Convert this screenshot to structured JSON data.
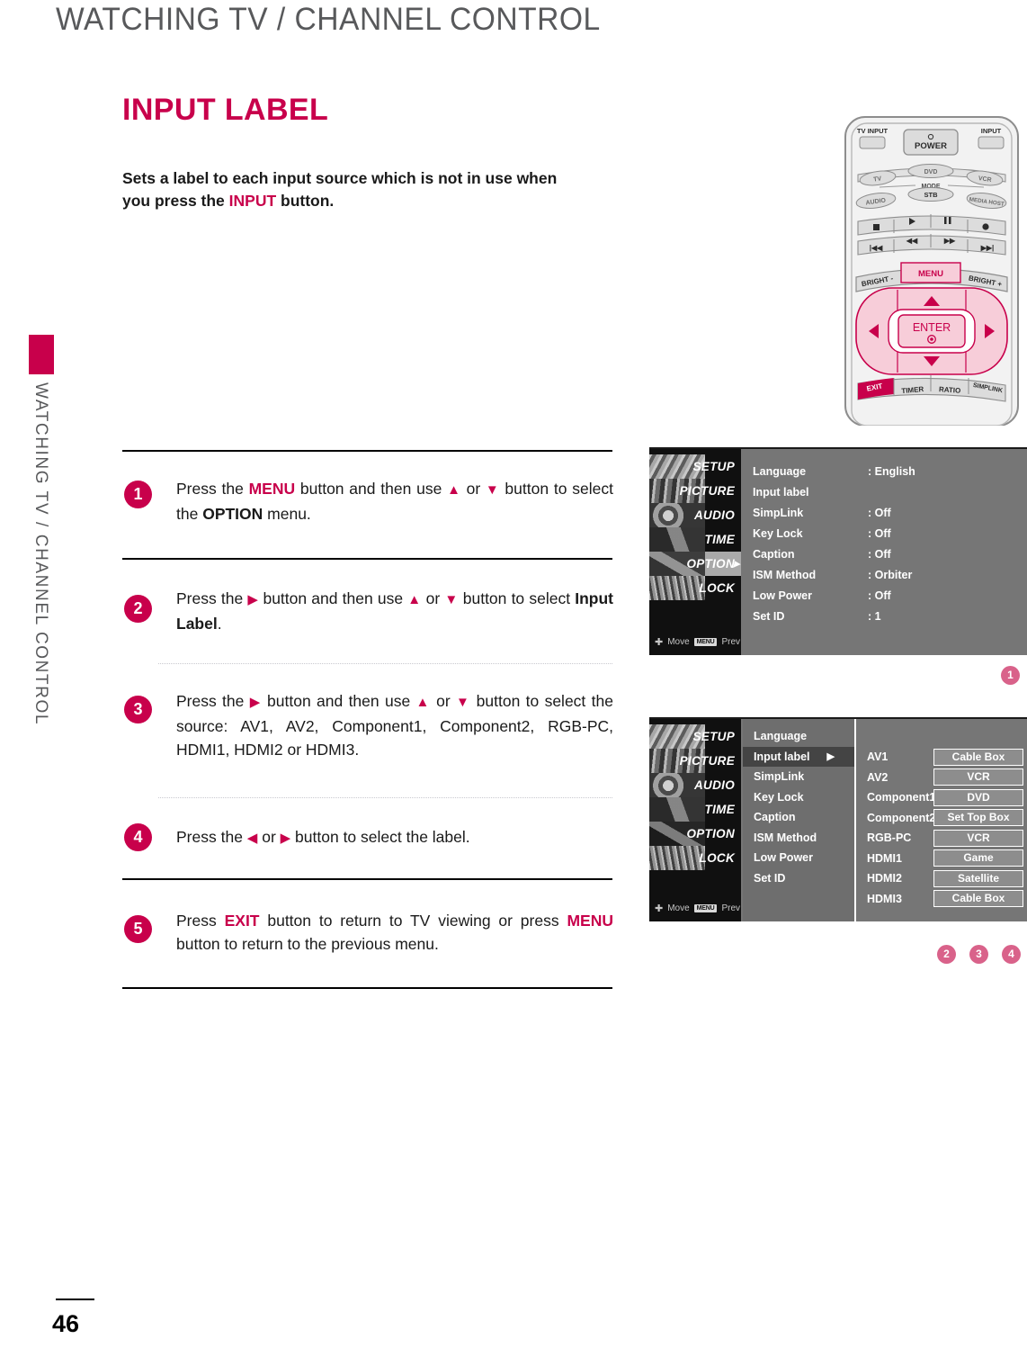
{
  "header": {
    "title": "WATCHING TV / CHANNEL CONTROL"
  },
  "sidebar": {
    "vertical_label": "WATCHING TV / CHANNEL CONTROL"
  },
  "footer": {
    "page_number": "46"
  },
  "section": {
    "title": "INPUT LABEL",
    "intro_line1": "Sets a label to each input source which is not in use when",
    "intro_line2_pre": "you press the ",
    "intro_highlight": "INPUT",
    "intro_line2_post": " button."
  },
  "steps": [
    {
      "num": "1",
      "parts": [
        {
          "t": "Press the ",
          "s": "plain"
        },
        {
          "t": "MENU",
          "s": "pink"
        },
        {
          "t": " button and then use ",
          "s": "plain"
        },
        {
          "t": "▲",
          "s": "tri"
        },
        {
          "t": " or ",
          "s": "plain"
        },
        {
          "t": "▼",
          "s": "tri"
        },
        {
          "t": " button to select the ",
          "s": "plain"
        },
        {
          "t": "OPTION",
          "s": "bold"
        },
        {
          "t": " menu.",
          "s": "plain"
        }
      ]
    },
    {
      "num": "2",
      "parts": [
        {
          "t": "Press the ",
          "s": "plain"
        },
        {
          "t": "▶",
          "s": "tri"
        },
        {
          "t": " button and then use ",
          "s": "plain"
        },
        {
          "t": "▲",
          "s": "tri"
        },
        {
          "t": " or ",
          "s": "plain"
        },
        {
          "t": "▼",
          "s": "tri"
        },
        {
          "t": " button to select ",
          "s": "plain"
        },
        {
          "t": "Input Label",
          "s": "bold"
        },
        {
          "t": ".",
          "s": "plain"
        }
      ]
    },
    {
      "num": "3",
      "parts": [
        {
          "t": "Press the ",
          "s": "plain"
        },
        {
          "t": "▶",
          "s": "tri"
        },
        {
          "t": " button and then use ",
          "s": "plain"
        },
        {
          "t": "▲",
          "s": "tri"
        },
        {
          "t": " or ",
          "s": "plain"
        },
        {
          "t": "▼",
          "s": "tri"
        },
        {
          "t": " button to select the source: AV1, AV2, Component1, Component2, RGB-PC, HDMI1, HDMI2 or HDMI3.",
          "s": "plain"
        }
      ]
    },
    {
      "num": "4",
      "parts": [
        {
          "t": "Press the ",
          "s": "plain"
        },
        {
          "t": "◀",
          "s": "tri"
        },
        {
          "t": " or ",
          "s": "plain"
        },
        {
          "t": "▶",
          "s": "tri"
        },
        {
          "t": " button to select the label.",
          "s": "plain"
        }
      ]
    },
    {
      "num": "5",
      "parts": [
        {
          "t": "Press ",
          "s": "plain"
        },
        {
          "t": "EXIT",
          "s": "pink"
        },
        {
          "t": " button to return to TV viewing or press ",
          "s": "plain"
        },
        {
          "t": "MENU",
          "s": "pink"
        },
        {
          "t": " button to return to the previous menu.",
          "s": "plain"
        }
      ]
    }
  ],
  "osd_menu_1": {
    "sidebar_items": [
      {
        "label": "SETUP",
        "selected": false
      },
      {
        "label": "PICTURE",
        "selected": false
      },
      {
        "label": "AUDIO",
        "selected": false
      },
      {
        "label": "TIME",
        "selected": false
      },
      {
        "label": "OPTION",
        "selected": true
      },
      {
        "label": "LOCK",
        "selected": false
      }
    ],
    "footer": {
      "move": "Move",
      "menu_key": "MENU",
      "prev": "Prev"
    },
    "rows": [
      {
        "key": "Language",
        "value": ": English"
      },
      {
        "key": "Input label",
        "value": ""
      },
      {
        "key": "SimpLink",
        "value": ": Off"
      },
      {
        "key": "Key Lock",
        "value": ": Off"
      },
      {
        "key": "Caption",
        "value": ": Off"
      },
      {
        "key": "ISM Method",
        "value": ": Orbiter"
      },
      {
        "key": "Low Power",
        "value": ": Off"
      },
      {
        "key": "Set ID",
        "value": ": 1"
      }
    ],
    "callout": "1"
  },
  "osd_menu_2": {
    "sidebar_items": [
      {
        "label": "SETUP",
        "selected": false
      },
      {
        "label": "PICTURE",
        "selected": false
      },
      {
        "label": "AUDIO",
        "selected": false
      },
      {
        "label": "TIME",
        "selected": false
      },
      {
        "label": "OPTION",
        "selected": false
      },
      {
        "label": "LOCK",
        "selected": false
      }
    ],
    "footer": {
      "move": "Move",
      "menu_key": "MENU",
      "prev": "Prev"
    },
    "middle_items": [
      {
        "label": "Language",
        "selected": false,
        "arrow": ""
      },
      {
        "label": "Input label",
        "selected": true,
        "arrow": "▶"
      },
      {
        "label": "SimpLink",
        "selected": false,
        "arrow": ""
      },
      {
        "label": "Key Lock",
        "selected": false,
        "arrow": ""
      },
      {
        "label": "Caption",
        "selected": false,
        "arrow": ""
      },
      {
        "label": "ISM Method",
        "selected": false,
        "arrow": ""
      },
      {
        "label": "Low Power",
        "selected": false,
        "arrow": ""
      },
      {
        "label": "Set ID",
        "selected": false,
        "arrow": ""
      }
    ],
    "input_labels": [
      {
        "source": "AV1",
        "label": "Cable Box"
      },
      {
        "source": "AV2",
        "label": "VCR"
      },
      {
        "source": "Component1",
        "label": "DVD"
      },
      {
        "source": "Component2",
        "label": "Set Top Box"
      },
      {
        "source": "RGB-PC",
        "label": "VCR"
      },
      {
        "source": "HDMI1",
        "label": "Game"
      },
      {
        "source": "HDMI2",
        "label": "Satellite"
      },
      {
        "source": "HDMI3",
        "label": "Cable Box"
      }
    ],
    "callouts": [
      "2",
      "3",
      "4"
    ]
  },
  "remote": {
    "tv_input": "TV INPUT",
    "power": "POWER",
    "input": "INPUT",
    "mode_label": "MODE",
    "mode_top": [
      "TV",
      "DVD",
      "VCR"
    ],
    "mode_bottom": [
      "AUDIO",
      "STB",
      "MEDIA HOST"
    ],
    "bright_minus": "BRIGHT -",
    "menu": "MENU",
    "bright_plus": "BRIGHT +",
    "enter": "ENTER",
    "exit": "EXIT",
    "timer": "TIMER",
    "ratio": "RATIO",
    "simplink": "SIMPLINK"
  },
  "colors": {
    "brand_pink": "#c8004b",
    "callout_pink": "#d9628a",
    "header_gray": "#58595b",
    "osd_bg": "#767676",
    "osd_sidebar": "#101010"
  }
}
